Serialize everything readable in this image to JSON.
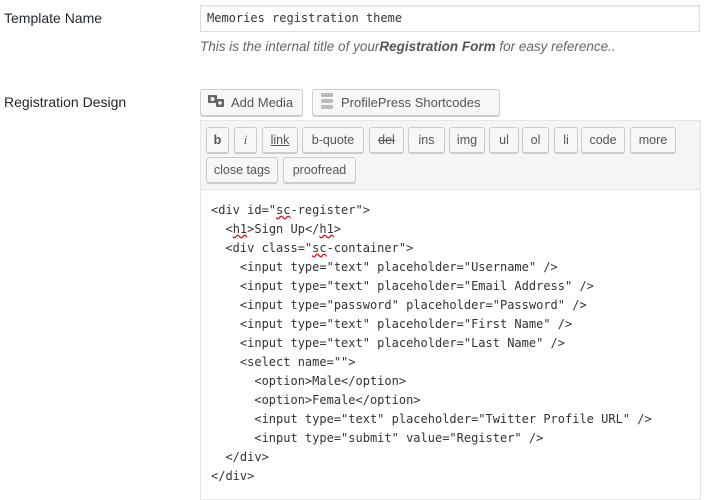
{
  "template_name": {
    "label": "Template Name",
    "value": "Memories registration theme",
    "description_prefix": "This is the internal title of your",
    "description_bold": "Registration Form",
    "description_suffix": " for easy reference.."
  },
  "registration_design": {
    "label": "Registration Design",
    "add_media_label": "Add Media",
    "shortcodes_label": "ProfilePress Shortcodes",
    "toolbar_buttons": [
      "b",
      "i",
      "link",
      "b-quote",
      "del",
      "ins",
      "img",
      "ul",
      "ol",
      "li",
      "code",
      "more",
      "close tags",
      "proofread"
    ],
    "code_lines": [
      "<div id=\"sc-register\">",
      "  <h1>Sign Up</h1>",
      "  <div class=\"sc-container\">",
      "    <input type=\"text\" placeholder=\"Username\" />",
      "    <input type=\"text\" placeholder=\"Email Address\" />",
      "    <input type=\"password\" placeholder=\"Password\" />",
      "    <input type=\"text\" placeholder=\"First Name\" />",
      "    <input type=\"text\" placeholder=\"Last Name\" />",
      "    <select name=\"\">",
      "      <option>Male</option>",
      "      <option>Female</option>",
      "      <input type=\"text\" placeholder=\"Twitter Profile URL\" />",
      "      <input type=\"submit\" value=\"Register\" />",
      "  </div>",
      "</div>"
    ]
  },
  "icons": {
    "add_media": "media-camera-icon",
    "shortcodes": "stack-icon"
  }
}
